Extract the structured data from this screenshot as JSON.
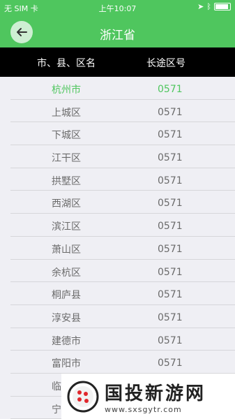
{
  "status": {
    "carrier": "无 SIM 卡 ",
    "time": "上午10:07"
  },
  "nav": {
    "title": "浙江省"
  },
  "header": {
    "col1": "市、县、区名",
    "col2": "长途区号"
  },
  "rows": [
    {
      "name": "杭州市",
      "code": "0571"
    },
    {
      "name": "上城区",
      "code": "0571"
    },
    {
      "name": "下城区",
      "code": "0571"
    },
    {
      "name": "江干区",
      "code": "0571"
    },
    {
      "name": "拱墅区",
      "code": "0571"
    },
    {
      "name": "西湖区",
      "code": "0571"
    },
    {
      "name": "滨江区",
      "code": "0571"
    },
    {
      "name": "萧山区",
      "code": "0571"
    },
    {
      "name": "余杭区",
      "code": "0571"
    },
    {
      "name": "桐庐县",
      "code": "0571"
    },
    {
      "name": "淳安县",
      "code": "0571"
    },
    {
      "name": "建德市",
      "code": "0571"
    },
    {
      "name": "富阳市",
      "code": "0571"
    },
    {
      "name": "临",
      "code": ""
    },
    {
      "name": "宁",
      "code": ""
    }
  ],
  "watermark": {
    "title": "国投新游网",
    "url": "www.sxsgytr.com"
  },
  "colors": {
    "accent": "#4fc65e"
  }
}
